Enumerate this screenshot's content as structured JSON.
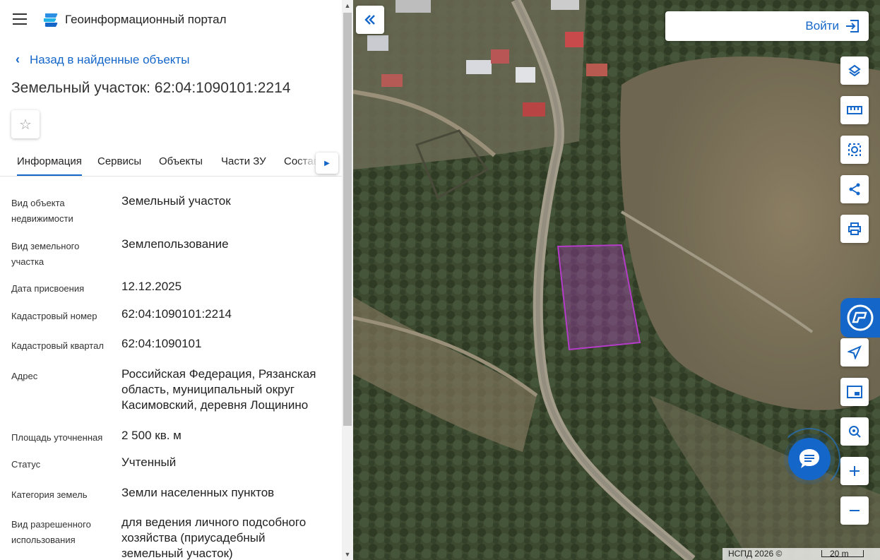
{
  "header": {
    "title": "Геоинформационный портал",
    "menu_icon": "menu-icon",
    "logo_icon": "portal-logo-icon"
  },
  "back_link": {
    "label": "Назад в найденные объекты"
  },
  "object": {
    "title": "Земельный участок: 62:04:1090101:2214"
  },
  "tabs": [
    {
      "label": "Информация",
      "active": true
    },
    {
      "label": "Сервисы",
      "active": false
    },
    {
      "label": "Объекты",
      "active": false
    },
    {
      "label": "Части ЗУ",
      "active": false
    },
    {
      "label": "Состав",
      "active": false
    }
  ],
  "info": [
    {
      "label": "Вид объекта недвижимости",
      "value": "Земельный участок"
    },
    {
      "label": "Вид земельного участка",
      "value": "Землепользование"
    },
    {
      "label": "Дата присвоения",
      "value": "12.12.2025"
    },
    {
      "label": "Кадастровый номер",
      "value": "62:04:1090101:2214"
    },
    {
      "label": "Кадастровый квартал",
      "value": "62:04:1090101"
    },
    {
      "label": "Адрес",
      "value": "Российская Федерация, Рязанская область, муниципальный округ Касимовский, деревня Лощинино"
    },
    {
      "label": "Площадь уточненная",
      "value": "2 500 кв. м"
    },
    {
      "label": "Статус",
      "value": "Учтенный"
    },
    {
      "label": "Категория земель",
      "value": "Земли населенных пунктов"
    },
    {
      "label": "Вид разрешенного использования",
      "value": "для ведения личного подсобного хозяйства (приусадебный земельный участок)"
    }
  ],
  "map": {
    "login_label": "Войти",
    "copyright": "НСПД 2026 ©",
    "scale": "20 m",
    "parcel_color": "#b43cc8",
    "accent_color": "#1466c9"
  }
}
